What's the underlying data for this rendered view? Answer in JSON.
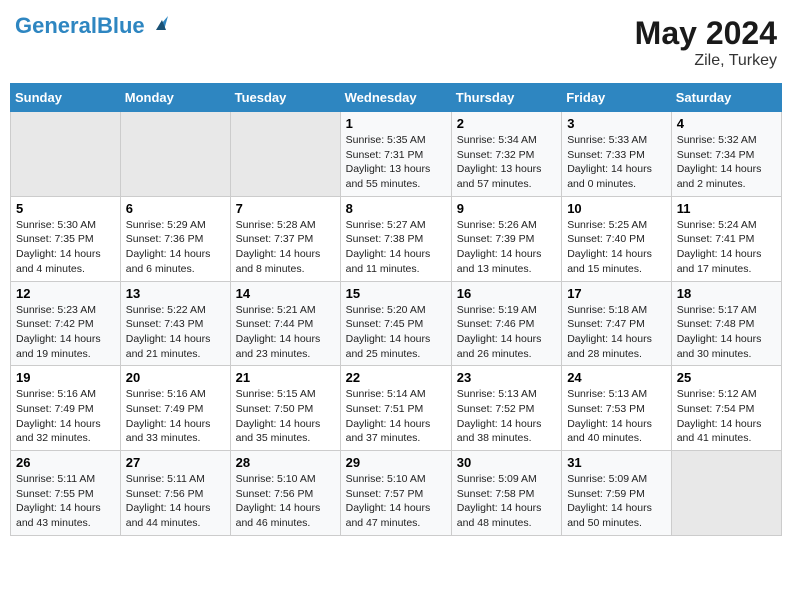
{
  "header": {
    "logo_line1": "General",
    "logo_line2": "Blue",
    "month_year": "May 2024",
    "location": "Zile, Turkey"
  },
  "days_of_week": [
    "Sunday",
    "Monday",
    "Tuesday",
    "Wednesday",
    "Thursday",
    "Friday",
    "Saturday"
  ],
  "weeks": [
    [
      {
        "day": "",
        "sunrise": "",
        "sunset": "",
        "daylight": "",
        "empty": true
      },
      {
        "day": "",
        "sunrise": "",
        "sunset": "",
        "daylight": "",
        "empty": true
      },
      {
        "day": "",
        "sunrise": "",
        "sunset": "",
        "daylight": "",
        "empty": true
      },
      {
        "day": "1",
        "sunrise": "Sunrise: 5:35 AM",
        "sunset": "Sunset: 7:31 PM",
        "daylight": "Daylight: 13 hours and 55 minutes."
      },
      {
        "day": "2",
        "sunrise": "Sunrise: 5:34 AM",
        "sunset": "Sunset: 7:32 PM",
        "daylight": "Daylight: 13 hours and 57 minutes."
      },
      {
        "day": "3",
        "sunrise": "Sunrise: 5:33 AM",
        "sunset": "Sunset: 7:33 PM",
        "daylight": "Daylight: 14 hours and 0 minutes."
      },
      {
        "day": "4",
        "sunrise": "Sunrise: 5:32 AM",
        "sunset": "Sunset: 7:34 PM",
        "daylight": "Daylight: 14 hours and 2 minutes."
      }
    ],
    [
      {
        "day": "5",
        "sunrise": "Sunrise: 5:30 AM",
        "sunset": "Sunset: 7:35 PM",
        "daylight": "Daylight: 14 hours and 4 minutes."
      },
      {
        "day": "6",
        "sunrise": "Sunrise: 5:29 AM",
        "sunset": "Sunset: 7:36 PM",
        "daylight": "Daylight: 14 hours and 6 minutes."
      },
      {
        "day": "7",
        "sunrise": "Sunrise: 5:28 AM",
        "sunset": "Sunset: 7:37 PM",
        "daylight": "Daylight: 14 hours and 8 minutes."
      },
      {
        "day": "8",
        "sunrise": "Sunrise: 5:27 AM",
        "sunset": "Sunset: 7:38 PM",
        "daylight": "Daylight: 14 hours and 11 minutes."
      },
      {
        "day": "9",
        "sunrise": "Sunrise: 5:26 AM",
        "sunset": "Sunset: 7:39 PM",
        "daylight": "Daylight: 14 hours and 13 minutes."
      },
      {
        "day": "10",
        "sunrise": "Sunrise: 5:25 AM",
        "sunset": "Sunset: 7:40 PM",
        "daylight": "Daylight: 14 hours and 15 minutes."
      },
      {
        "day": "11",
        "sunrise": "Sunrise: 5:24 AM",
        "sunset": "Sunset: 7:41 PM",
        "daylight": "Daylight: 14 hours and 17 minutes."
      }
    ],
    [
      {
        "day": "12",
        "sunrise": "Sunrise: 5:23 AM",
        "sunset": "Sunset: 7:42 PM",
        "daylight": "Daylight: 14 hours and 19 minutes."
      },
      {
        "day": "13",
        "sunrise": "Sunrise: 5:22 AM",
        "sunset": "Sunset: 7:43 PM",
        "daylight": "Daylight: 14 hours and 21 minutes."
      },
      {
        "day": "14",
        "sunrise": "Sunrise: 5:21 AM",
        "sunset": "Sunset: 7:44 PM",
        "daylight": "Daylight: 14 hours and 23 minutes."
      },
      {
        "day": "15",
        "sunrise": "Sunrise: 5:20 AM",
        "sunset": "Sunset: 7:45 PM",
        "daylight": "Daylight: 14 hours and 25 minutes."
      },
      {
        "day": "16",
        "sunrise": "Sunrise: 5:19 AM",
        "sunset": "Sunset: 7:46 PM",
        "daylight": "Daylight: 14 hours and 26 minutes."
      },
      {
        "day": "17",
        "sunrise": "Sunrise: 5:18 AM",
        "sunset": "Sunset: 7:47 PM",
        "daylight": "Daylight: 14 hours and 28 minutes."
      },
      {
        "day": "18",
        "sunrise": "Sunrise: 5:17 AM",
        "sunset": "Sunset: 7:48 PM",
        "daylight": "Daylight: 14 hours and 30 minutes."
      }
    ],
    [
      {
        "day": "19",
        "sunrise": "Sunrise: 5:16 AM",
        "sunset": "Sunset: 7:49 PM",
        "daylight": "Daylight: 14 hours and 32 minutes."
      },
      {
        "day": "20",
        "sunrise": "Sunrise: 5:16 AM",
        "sunset": "Sunset: 7:49 PM",
        "daylight": "Daylight: 14 hours and 33 minutes."
      },
      {
        "day": "21",
        "sunrise": "Sunrise: 5:15 AM",
        "sunset": "Sunset: 7:50 PM",
        "daylight": "Daylight: 14 hours and 35 minutes."
      },
      {
        "day": "22",
        "sunrise": "Sunrise: 5:14 AM",
        "sunset": "Sunset: 7:51 PM",
        "daylight": "Daylight: 14 hours and 37 minutes."
      },
      {
        "day": "23",
        "sunrise": "Sunrise: 5:13 AM",
        "sunset": "Sunset: 7:52 PM",
        "daylight": "Daylight: 14 hours and 38 minutes."
      },
      {
        "day": "24",
        "sunrise": "Sunrise: 5:13 AM",
        "sunset": "Sunset: 7:53 PM",
        "daylight": "Daylight: 14 hours and 40 minutes."
      },
      {
        "day": "25",
        "sunrise": "Sunrise: 5:12 AM",
        "sunset": "Sunset: 7:54 PM",
        "daylight": "Daylight: 14 hours and 41 minutes."
      }
    ],
    [
      {
        "day": "26",
        "sunrise": "Sunrise: 5:11 AM",
        "sunset": "Sunset: 7:55 PM",
        "daylight": "Daylight: 14 hours and 43 minutes."
      },
      {
        "day": "27",
        "sunrise": "Sunrise: 5:11 AM",
        "sunset": "Sunset: 7:56 PM",
        "daylight": "Daylight: 14 hours and 44 minutes."
      },
      {
        "day": "28",
        "sunrise": "Sunrise: 5:10 AM",
        "sunset": "Sunset: 7:56 PM",
        "daylight": "Daylight: 14 hours and 46 minutes."
      },
      {
        "day": "29",
        "sunrise": "Sunrise: 5:10 AM",
        "sunset": "Sunset: 7:57 PM",
        "daylight": "Daylight: 14 hours and 47 minutes."
      },
      {
        "day": "30",
        "sunrise": "Sunrise: 5:09 AM",
        "sunset": "Sunset: 7:58 PM",
        "daylight": "Daylight: 14 hours and 48 minutes."
      },
      {
        "day": "31",
        "sunrise": "Sunrise: 5:09 AM",
        "sunset": "Sunset: 7:59 PM",
        "daylight": "Daylight: 14 hours and 50 minutes."
      },
      {
        "day": "",
        "sunrise": "",
        "sunset": "",
        "daylight": "",
        "empty": true
      }
    ]
  ]
}
